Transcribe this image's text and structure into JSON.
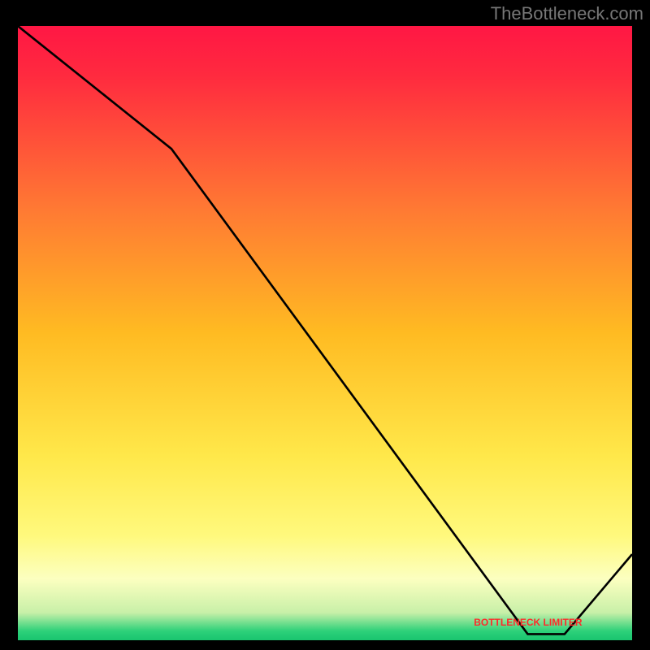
{
  "watermark": "TheBottleneck.com",
  "chart_data": {
    "type": "line",
    "title": "",
    "xlabel": "",
    "ylabel": "",
    "xlim": [
      0,
      100
    ],
    "ylim": [
      0,
      100
    ],
    "x": [
      0,
      25,
      83,
      89,
      100
    ],
    "values": [
      100,
      80,
      1,
      1,
      14
    ],
    "limiter_label": "BOTTLENECK LIMITER",
    "limiter_position_x": 86,
    "limiter_position_y": 2,
    "gradient_stops": [
      {
        "offset": 0.0,
        "color": "#ff1744"
      },
      {
        "offset": 0.08,
        "color": "#ff2a3f"
      },
      {
        "offset": 0.3,
        "color": "#ff7a33"
      },
      {
        "offset": 0.5,
        "color": "#ffbb22"
      },
      {
        "offset": 0.7,
        "color": "#ffe84a"
      },
      {
        "offset": 0.83,
        "color": "#fff97d"
      },
      {
        "offset": 0.9,
        "color": "#fcffc0"
      },
      {
        "offset": 0.955,
        "color": "#c8f0a8"
      },
      {
        "offset": 0.985,
        "color": "#2dd17a"
      },
      {
        "offset": 1.0,
        "color": "#19c46f"
      }
    ]
  }
}
